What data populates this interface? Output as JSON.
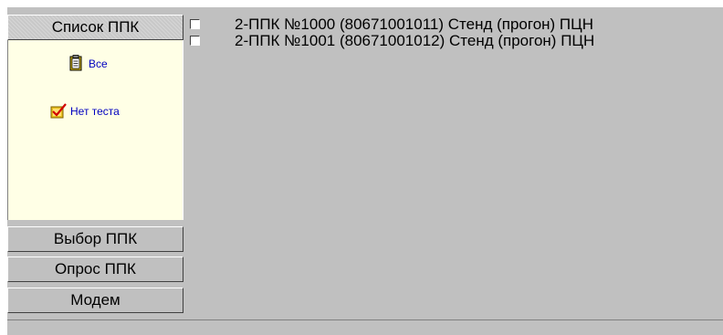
{
  "sidebar": {
    "header_list": "Список ППК",
    "shortcuts": [
      {
        "label": "Все",
        "icon": "clipboard-icon"
      },
      {
        "label": "Нет теста",
        "icon": "checked-box-icon"
      }
    ],
    "header_select": "Выбор ППК",
    "header_poll": "Опрос ППК",
    "header_modem": "Модем"
  },
  "devices": [
    {
      "label": "2-ППК №1000 (80671001011) Стенд (прогон) ПЦН",
      "checked": false
    },
    {
      "label": "2-ППК №1001 (80671001012) Стенд (прогон) ПЦН",
      "checked": false
    }
  ],
  "colors": {
    "panel_bg": "#c0c0c0",
    "shortcut_bg": "#ffffe6",
    "link_text": "#0000c0"
  }
}
